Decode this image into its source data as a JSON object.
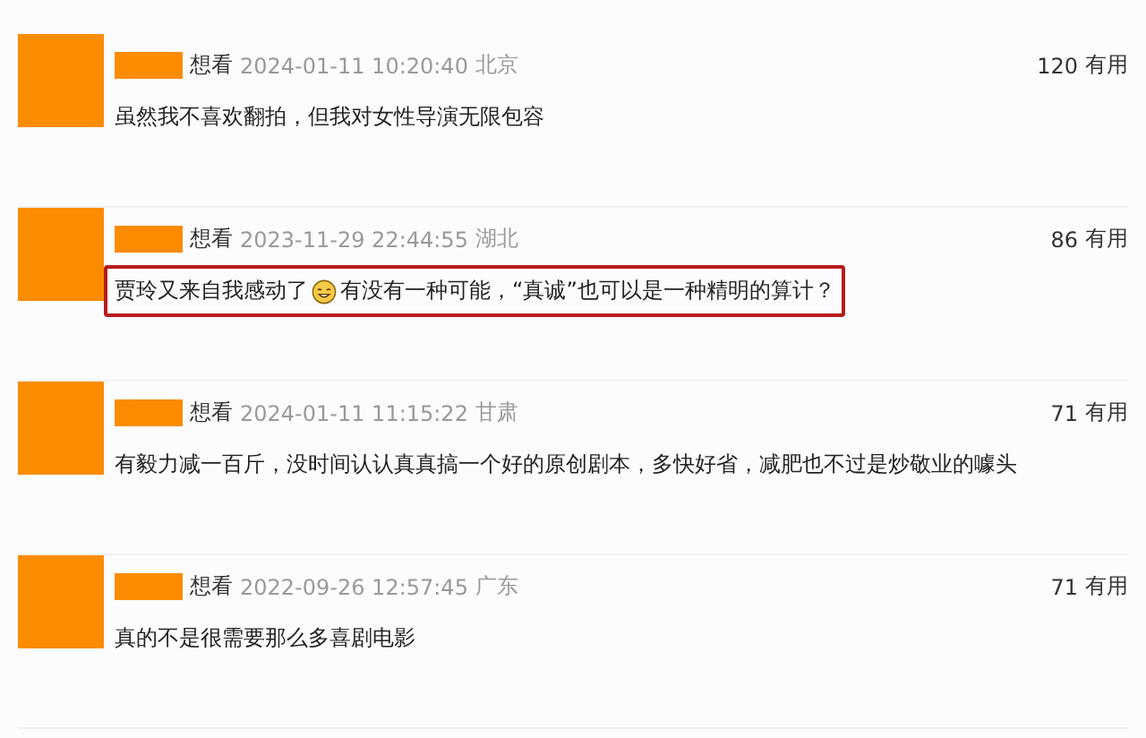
{
  "comments": [
    {
      "status": "想看",
      "time": "2024-01-11 10:20:40",
      "location": "北京",
      "votes": "120",
      "vote_label": "有用",
      "highlighted": false,
      "text": "虽然我不喜欢翻拍，但我对女性导演无限包容"
    },
    {
      "status": "想看",
      "time": "2023-11-29 22:44:55",
      "location": "湖北",
      "votes": "86",
      "vote_label": "有用",
      "highlighted": true,
      "text": "贾玲又来自我感动了",
      "text_after_emoji": "有没有一种可能，“真诚”也可以是一种精明的算计？"
    },
    {
      "status": "想看",
      "time": "2024-01-11 11:15:22",
      "location": "甘肃",
      "votes": "71",
      "vote_label": "有用",
      "highlighted": false,
      "text": "有毅力减一百斤，没时间认认真真搞一个好的原创剧本，多快好省，减肥也不过是炒敬业的噱头"
    },
    {
      "status": "想看",
      "time": "2022-09-26 12:57:45",
      "location": "广东",
      "votes": "71",
      "vote_label": "有用",
      "highlighted": false,
      "text": "真的不是很需要那么多喜剧电影"
    }
  ]
}
